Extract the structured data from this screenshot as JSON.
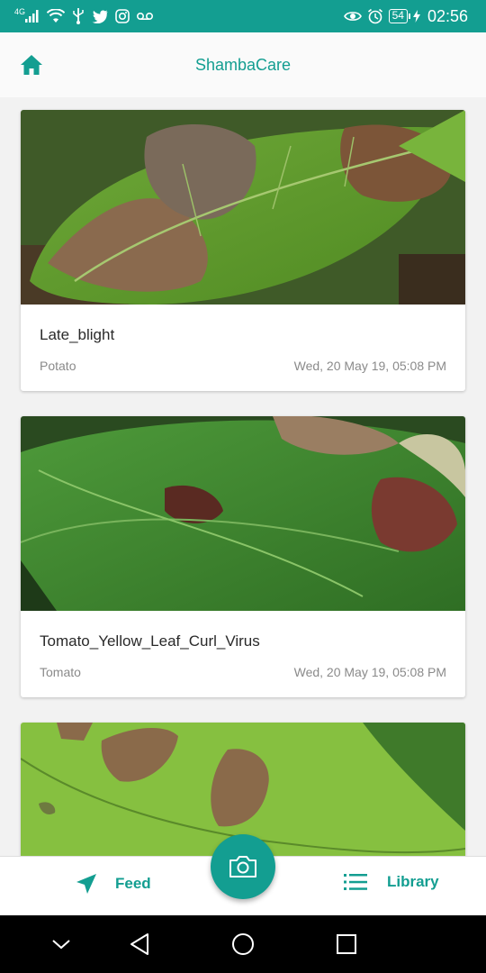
{
  "status_bar": {
    "network_label": "4G",
    "battery_level": "54",
    "time": "02:56"
  },
  "app_bar": {
    "title": "ShambaCare"
  },
  "feed": {
    "cards": [
      {
        "title": "Late_blight",
        "crop": "Potato",
        "date": "Wed, 20 May 19, 05:08 PM"
      },
      {
        "title": "Tomato_Yellow_Leaf_Curl_Virus",
        "crop": "Tomato",
        "date": "Wed, 20 May 19, 05:08 PM"
      },
      {
        "title": "",
        "crop": "",
        "date": ""
      }
    ]
  },
  "bottom_nav": {
    "feed_label": "Feed",
    "library_label": "Library"
  },
  "colors": {
    "accent": "#139e91",
    "background": "#f2f2f2"
  }
}
